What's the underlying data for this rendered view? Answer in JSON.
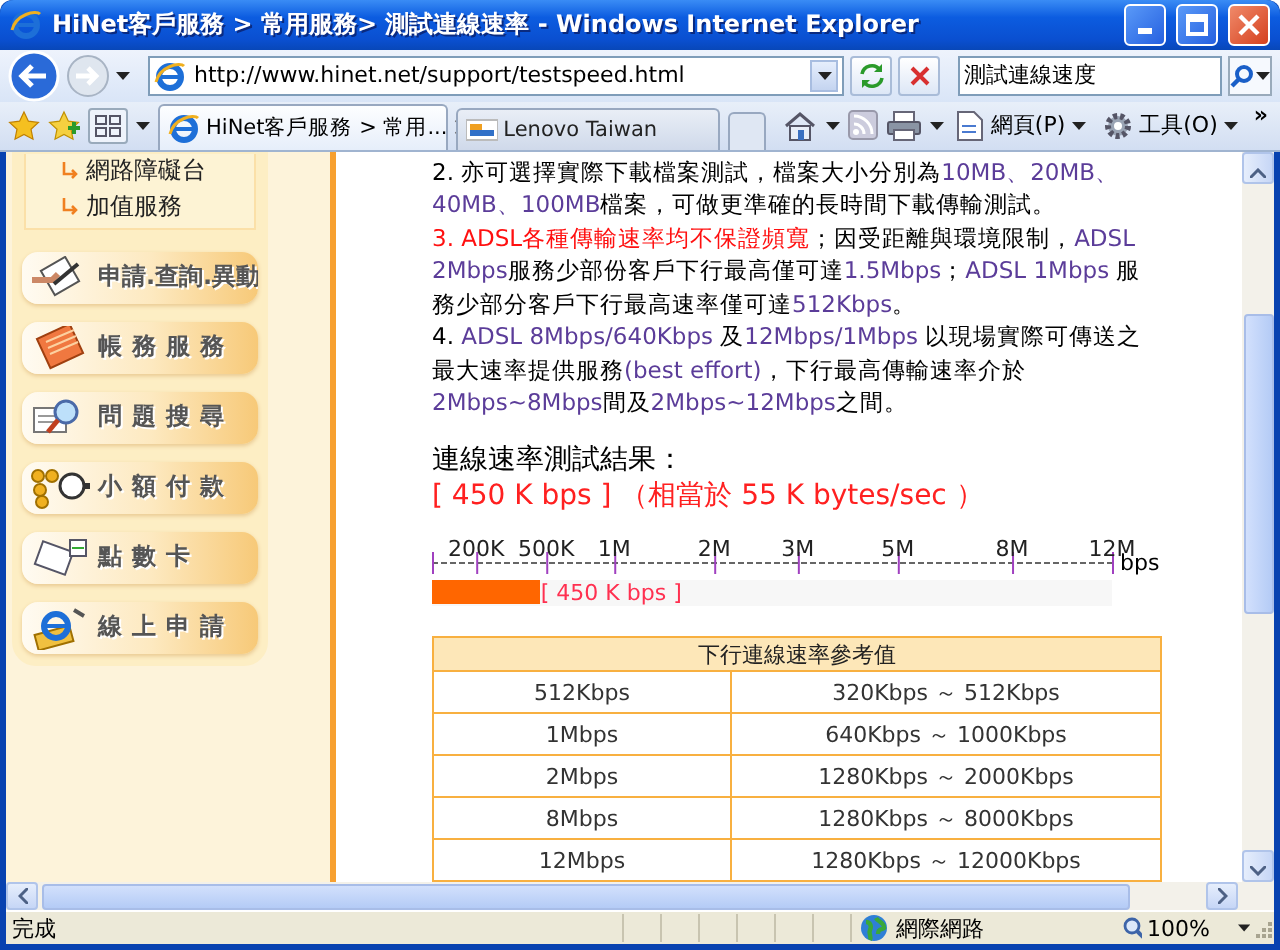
{
  "window": {
    "title": "HiNet客戶服務 > 常用服務> 測試連線速率 - Windows Internet Explorer"
  },
  "address_bar": {
    "url": "http://www.hinet.net/support/testspeed.html"
  },
  "search": {
    "value": "測試連線速度"
  },
  "tabs": [
    {
      "label": "HiNet客戶服務 > 常用...",
      "selected": true
    },
    {
      "label": "Lenovo Taiwan",
      "selected": false
    }
  ],
  "toolbar": {
    "page_menu": "網頁(P)",
    "tools_menu": "工具(O)",
    "overflow": "»"
  },
  "sidebar": {
    "links": [
      "網路障礙台",
      "加值服務"
    ],
    "buttons": [
      {
        "label": "申請.查詢.異動",
        "kind": "pen"
      },
      {
        "label": "帳務服務",
        "kind": "ledger"
      },
      {
        "label": "問題搜尋",
        "kind": "search"
      },
      {
        "label": "小額付款",
        "kind": "coins"
      },
      {
        "label": "點數卡",
        "kind": "card"
      },
      {
        "label": "線上申請",
        "kind": "ie"
      }
    ]
  },
  "notes": [
    [
      {
        "text": "2. 亦可選擇實際下載檔案測試，檔案大小分別為",
        "kind": "plain"
      },
      {
        "text": "10MB、20MB、40MB、100MB",
        "kind": "number"
      },
      {
        "text": "檔案，可做更準確的長時間下載傳輸測試。",
        "kind": "plain"
      }
    ],
    [
      {
        "text": "3. ADSL各種傳輸速率均不保證頻寬",
        "kind": "warning"
      },
      {
        "text": "；因受距離與環境限制，",
        "kind": "plain"
      },
      {
        "text": "ADSL 2Mbps",
        "kind": "number"
      },
      {
        "text": "服務少部份客戶下行最高僅可達",
        "kind": "plain"
      },
      {
        "text": "1.5Mbps",
        "kind": "number"
      },
      {
        "text": "；",
        "kind": "plain"
      },
      {
        "text": "ADSL 1Mbps ",
        "kind": "number"
      },
      {
        "text": "服務少部分客戶下行最高速率僅可達",
        "kind": "plain"
      },
      {
        "text": "512Kbps",
        "kind": "number"
      },
      {
        "text": "。",
        "kind": "plain"
      }
    ],
    [
      {
        "text": "4. ",
        "kind": "plain"
      },
      {
        "text": "ADSL 8Mbps/640Kbps",
        "kind": "number"
      },
      {
        "text": " 及",
        "kind": "plain"
      },
      {
        "text": "12Mbps/1Mbps",
        "kind": "number"
      },
      {
        "text": " 以現場實際可傳送之最大速率提供服務",
        "kind": "plain"
      },
      {
        "text": "(best effort)",
        "kind": "number"
      },
      {
        "text": "，下行最高傳輸速率介於",
        "kind": "plain"
      },
      {
        "text": "2Mbps~8Mbps",
        "kind": "number"
      },
      {
        "text": "間及",
        "kind": "plain"
      },
      {
        "text": "2Mbps~12Mbps",
        "kind": "number"
      },
      {
        "text": "之間。",
        "kind": "plain"
      }
    ]
  ],
  "result": {
    "heading": "連線速率測試結果：",
    "value": "[ 450 K bps ] （相當於 55 K bytes/sec ）"
  },
  "scale": {
    "ticks": [
      "200K",
      "500K",
      "1M",
      "2M",
      "3M",
      "5M",
      "8M",
      "12M"
    ],
    "unit": "bps",
    "level": 0.16,
    "reading": "[ 450 K bps ]"
  },
  "reference_table": {
    "title": "下行連線速率參考值",
    "rows": [
      [
        "512Kbps",
        "320Kbps ～ 512Kbps"
      ],
      [
        "1Mbps",
        "640Kbps ～ 1000Kbps"
      ],
      [
        "2Mbps",
        "1280Kbps ～ 2000Kbps"
      ],
      [
        "8Mbps",
        "1280Kbps ～ 8000Kbps"
      ],
      [
        "12Mbps",
        "1280Kbps ～ 12000Kbps"
      ]
    ]
  },
  "status_bar": {
    "text": "完成",
    "zone": "網際網路",
    "zoom": "100%"
  }
}
